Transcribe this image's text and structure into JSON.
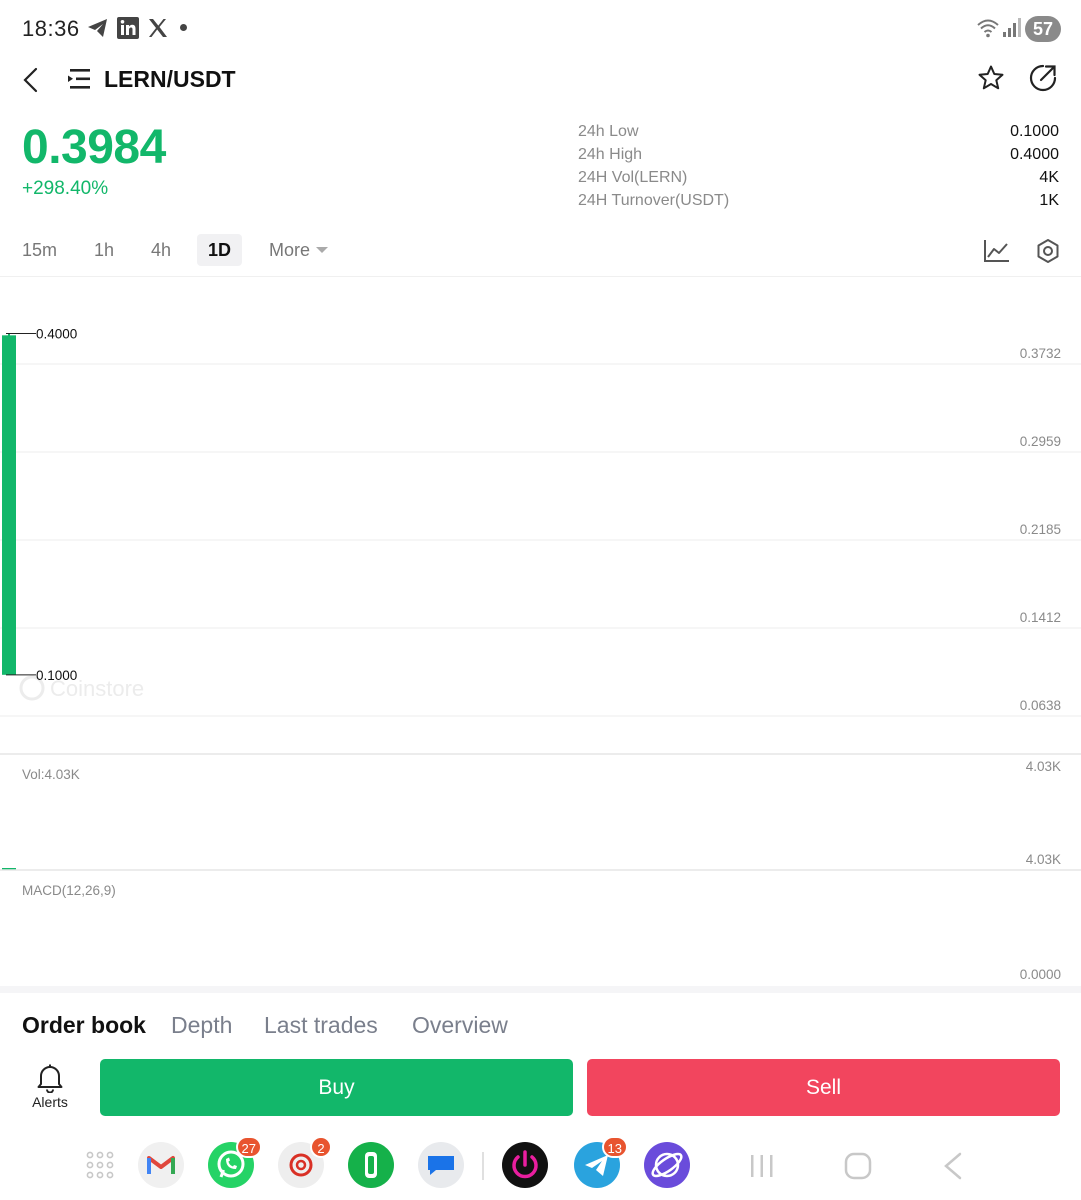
{
  "status_bar": {
    "time": "18:36",
    "battery": "57",
    "icons": [
      "telegram-icon",
      "linkedin-icon",
      "x-icon",
      "notification-dot",
      "wifi-icon",
      "signal-icon",
      "battery-icon"
    ]
  },
  "header": {
    "title": "LERN/USDT",
    "icons": [
      "back-icon",
      "menu-icon",
      "star-icon",
      "share-icon"
    ]
  },
  "ticker": {
    "price": "0.3984",
    "change": "+298.40%",
    "stats": [
      {
        "label": "24h Low",
        "value": "0.1000"
      },
      {
        "label": "24h High",
        "value": "0.4000"
      },
      {
        "label": "24H Vol(LERN)",
        "value": "4K"
      },
      {
        "label": "24H Turnover(USDT)",
        "value": "1K"
      }
    ]
  },
  "timeframes": {
    "items": [
      "15m",
      "1h",
      "4h",
      "1D",
      "More"
    ],
    "active": "1D",
    "icons": [
      "indicator-icon",
      "settings-icon"
    ]
  },
  "chart_data": {
    "type": "candlestick",
    "price_axis_ticks": [
      "0.3732",
      "0.2959",
      "0.2185",
      "0.1412",
      "0.0638"
    ],
    "candles": [
      {
        "open": 0.1,
        "close": 0.3984,
        "high": 0.4,
        "low": 0.1
      }
    ],
    "high_marker": "0.4000",
    "low_marker": "0.1000",
    "watermark": "Coinstore",
    "volume": {
      "label": "Vol:4.03K",
      "axis_top": "4.03K",
      "axis_bottom": "4.03K"
    },
    "macd": {
      "label": "MACD(12,26,9)",
      "axis_value": "0.0000"
    },
    "colors": {
      "up": "#12b76a",
      "grid": "#ececec"
    }
  },
  "bottom_tabs": {
    "items": [
      "Order book",
      "Depth",
      "Last trades",
      "Overview"
    ],
    "active": "Order book"
  },
  "actions": {
    "alerts_label": "Alerts",
    "buy_label": "Buy",
    "sell_label": "Sell",
    "colors": {
      "buy": "#12b76a",
      "sell": "#f2455e"
    }
  },
  "dock": {
    "apps": [
      {
        "name": "app-drawer-icon"
      },
      {
        "name": "gmail-icon"
      },
      {
        "name": "whatsapp-icon",
        "badge": "27"
      },
      {
        "name": "email-icon",
        "badge": "2"
      },
      {
        "name": "phone-icon"
      },
      {
        "name": "messages-icon"
      },
      {
        "name": "power-app-icon"
      },
      {
        "name": "telegram-app-icon",
        "badge": "13"
      },
      {
        "name": "browser-icon"
      }
    ],
    "nav": [
      "recents-icon",
      "home-icon",
      "nav-back-icon"
    ]
  }
}
